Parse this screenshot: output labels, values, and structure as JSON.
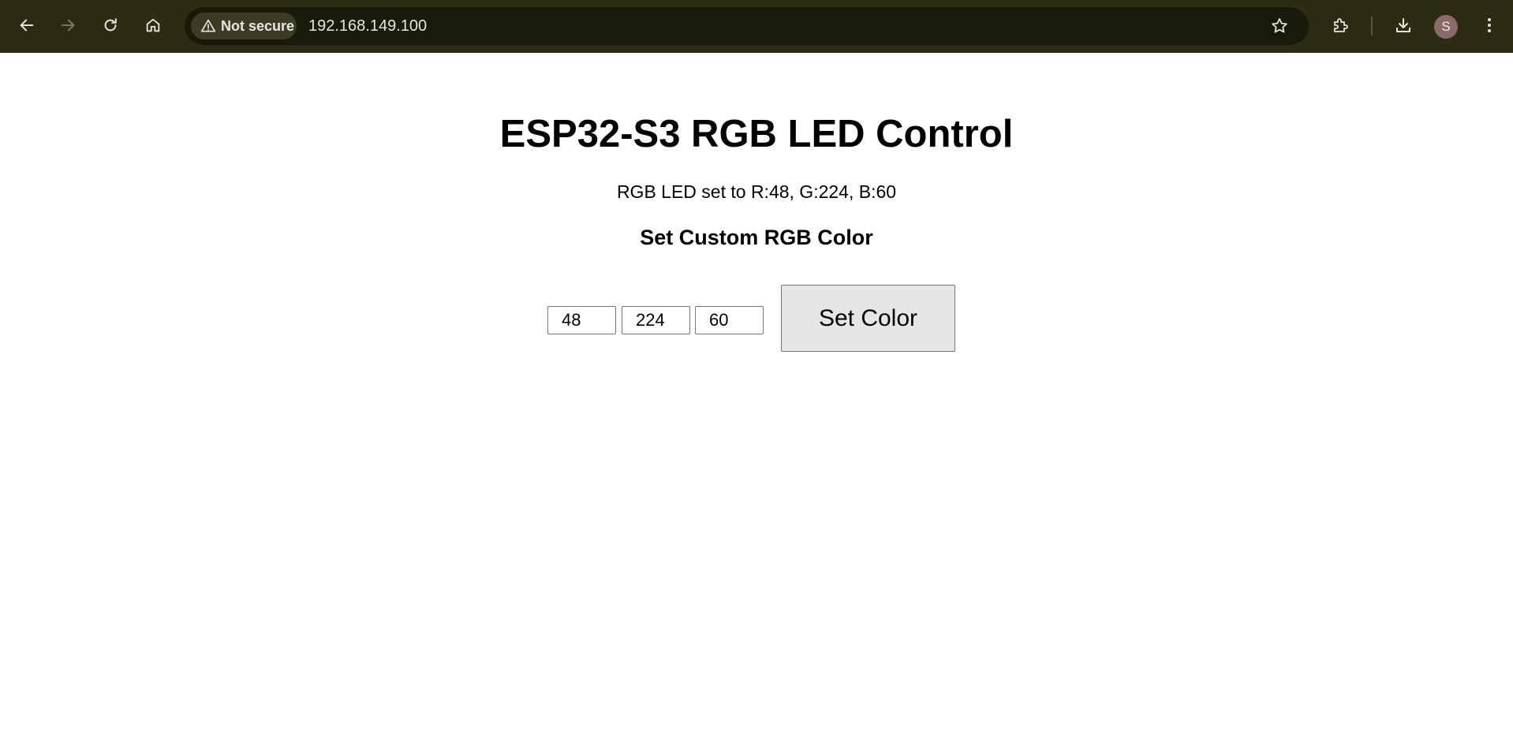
{
  "browser": {
    "security_chip": "Not secure",
    "url": "192.168.149.100",
    "profile_initial": "S",
    "toolbar_color": "#2c2c14",
    "icons": [
      "back-arrow-icon",
      "forward-arrow-icon",
      "reload-icon",
      "home-icon",
      "warning-icon",
      "bookmark-star-icon",
      "extensions-puzzle-icon",
      "download-icon",
      "kebab-menu-icon"
    ]
  },
  "page": {
    "title": "ESP32-S3 RGB LED Control",
    "status": "RGB LED set to R:48, G:224, B:60",
    "subheading": "Set Custom RGB Color",
    "form": {
      "r_value": "48",
      "g_value": "224",
      "b_value": "60",
      "submit_label": "Set Color"
    }
  }
}
